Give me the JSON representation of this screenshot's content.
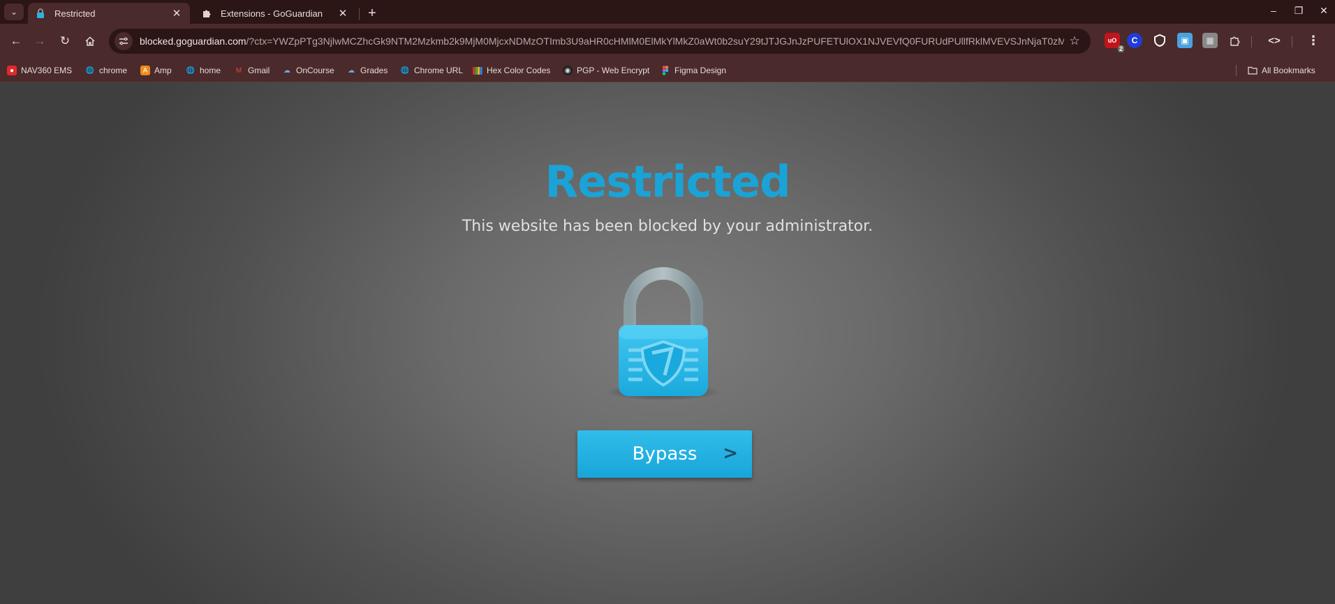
{
  "tabs": [
    {
      "title": "Restricted",
      "icon": "lock-icon",
      "active": true
    },
    {
      "title": "Extensions - GoGuardian",
      "icon": "puzzle-icon",
      "active": false
    }
  ],
  "toolbar": {
    "url_host": "blocked.goguardian.com",
    "url_rest": "/?ctx=YWZpPTg3NjlwMCZhcGk9NTM2Mzkmb2k9MjM0MjcxNDMzOTImb3U9aHR0cHMlM0ElMkYlMkZ0aWt0b2suY29tJTJGJnJzPUFETUlOX1NJVEVfQ0FURUdPUllfRklMVEVSJnNjaT0zMS..."
  },
  "extensions": [
    {
      "name": "ublock-icon",
      "badge": "2",
      "color": "#c0161b"
    },
    {
      "name": "c-extension-icon",
      "label": "C",
      "color": "#1f3dd6"
    },
    {
      "name": "shield-extension-icon",
      "color": "#ffffff"
    },
    {
      "name": "save-extension-icon",
      "color": "#4aa3e0"
    },
    {
      "name": "qr-extension-icon",
      "color": "#aaaaaa"
    }
  ],
  "bookmarks": [
    {
      "label": "NAV360 EMS",
      "icon": "bell-icon",
      "color": "#e02a2a"
    },
    {
      "label": "chrome",
      "icon": "globe-icon",
      "color": "#d8c8c8"
    },
    {
      "label": "Amp",
      "icon": "amp-icon",
      "color": "#f08a1c"
    },
    {
      "label": "home",
      "icon": "globe-icon",
      "color": "#d8c8c8"
    },
    {
      "label": "Gmail",
      "icon": "gmail-icon",
      "color": "#ea4335"
    },
    {
      "label": "OnCourse",
      "icon": "cloud-icon",
      "color": "#6aa8e0"
    },
    {
      "label": "Grades",
      "icon": "cloud-icon",
      "color": "#6aa8e0"
    },
    {
      "label": "Chrome URL",
      "icon": "globe-icon",
      "color": "#d8c8c8"
    },
    {
      "label": "Hex Color Codes",
      "icon": "color-bars-icon",
      "color": "#e8b030"
    },
    {
      "label": "PGP - Web Encrypt",
      "icon": "pgp-icon",
      "color": "#222222"
    },
    {
      "label": "Figma Design",
      "icon": "figma-icon",
      "color": "#f24e1e"
    }
  ],
  "all_bookmarks_label": "All Bookmarks",
  "page": {
    "title": "Restricted",
    "subtitle": "This website has been blocked by your administrator.",
    "bypass_label": "Bypass",
    "bypass_arrow": ">"
  },
  "colors": {
    "accent": "#1aa3d6",
    "chrome_frame": "#4a2a2a"
  }
}
